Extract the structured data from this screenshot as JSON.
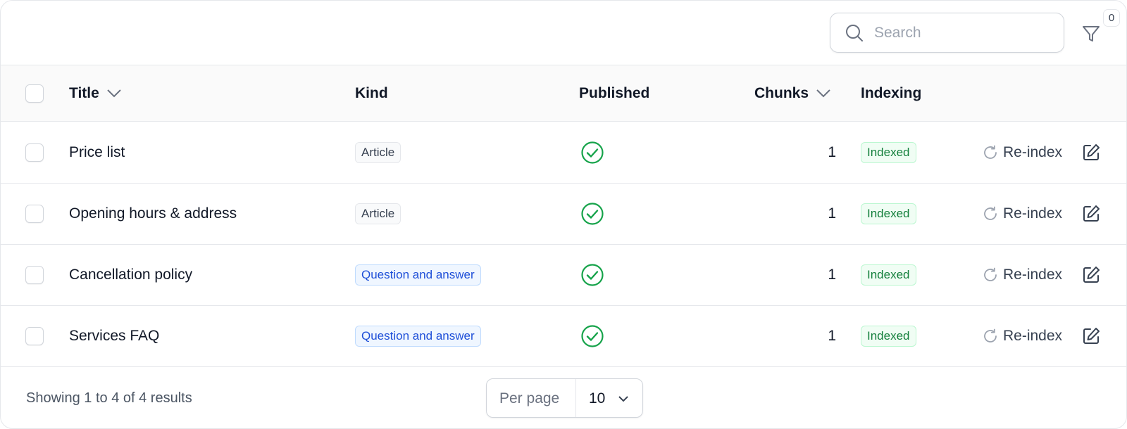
{
  "toolbar": {
    "search_placeholder": "Search",
    "search_icon": "search-icon",
    "filter_icon": "filter-icon",
    "filter_count": "0"
  },
  "table": {
    "columns": {
      "title": "Title",
      "kind": "Kind",
      "published": "Published",
      "chunks": "Chunks",
      "indexing": "Indexing"
    },
    "rows": [
      {
        "title": "Price list",
        "kind": "Article",
        "kind_type": "article",
        "published": true,
        "chunks": "1",
        "indexing": "Indexed",
        "action": "Re-index"
      },
      {
        "title": "Opening hours & address",
        "kind": "Article",
        "kind_type": "article",
        "published": true,
        "chunks": "1",
        "indexing": "Indexed",
        "action": "Re-index"
      },
      {
        "title": "Cancellation policy",
        "kind": "Question and answer",
        "kind_type": "qa",
        "published": true,
        "chunks": "1",
        "indexing": "Indexed",
        "action": "Re-index"
      },
      {
        "title": "Services FAQ",
        "kind": "Question and answer",
        "kind_type": "qa",
        "published": true,
        "chunks": "1",
        "indexing": "Indexed",
        "action": "Re-index"
      }
    ]
  },
  "footer": {
    "showing": "Showing 1 to 4 of 4 results",
    "per_page_label": "Per page",
    "per_page_value": "10"
  },
  "colors": {
    "published_check": "#16a34a",
    "qa_badge": "#1d4ed8",
    "indexed_badge": "#15803d"
  }
}
